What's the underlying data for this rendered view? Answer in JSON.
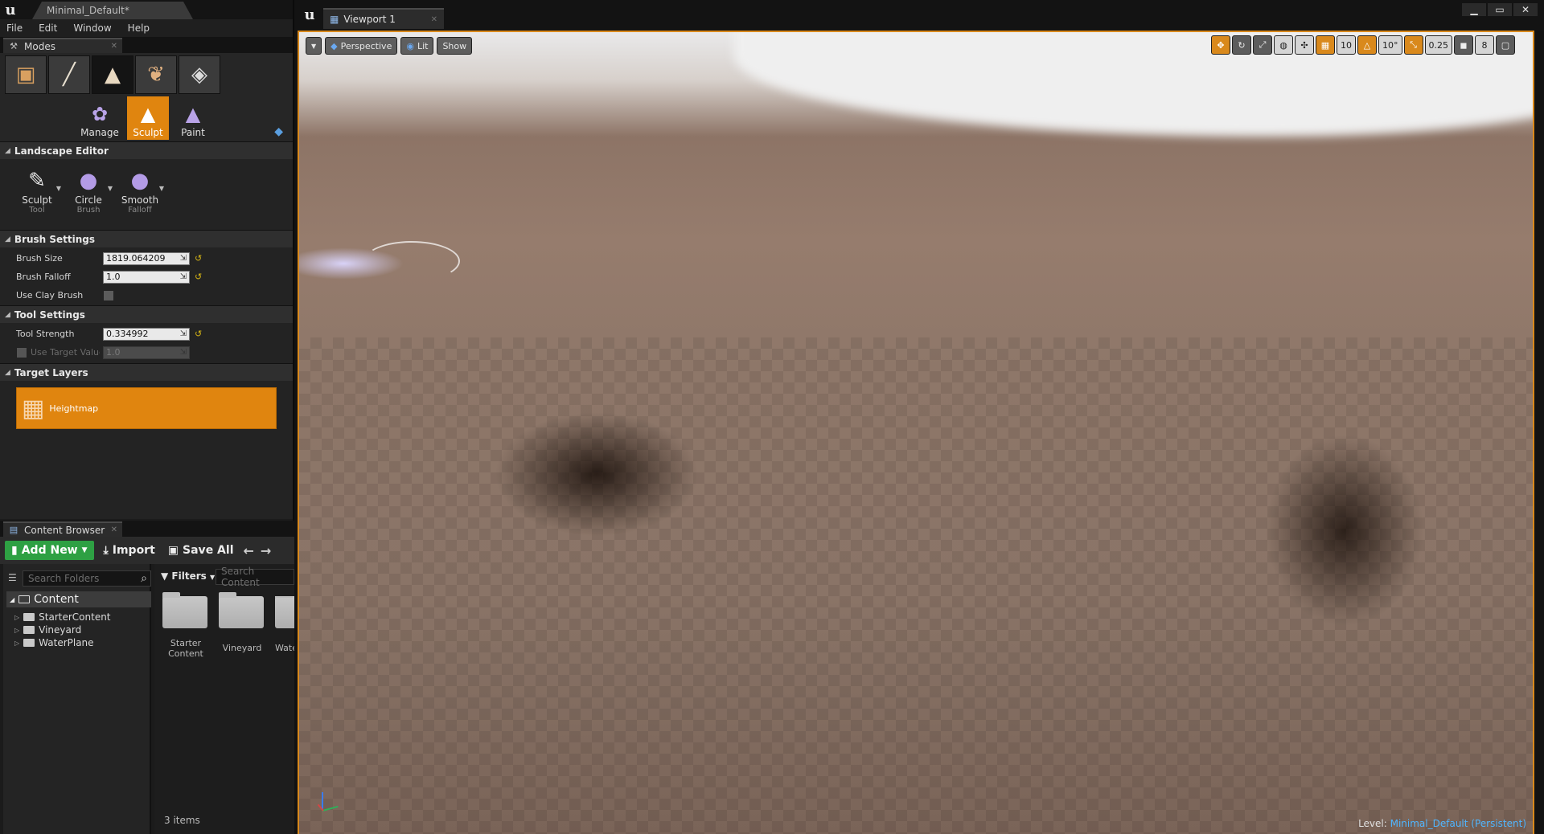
{
  "left_window": {
    "doc_tab": "Minimal_Default*",
    "menu": [
      "File",
      "Edit",
      "Window",
      "Help"
    ]
  },
  "modes": {
    "tab_label": "Modes",
    "mode_icons": [
      "place-mode-icon",
      "paint-mode-icon",
      "landscape-mode-icon",
      "foliage-mode-icon",
      "geometry-mode-icon"
    ],
    "tools": [
      "Manage",
      "Sculpt",
      "Paint"
    ],
    "active_tool": "Sculpt"
  },
  "landscape_editor": {
    "title": "Landscape Editor",
    "brush_tools": [
      {
        "line1": "Sculpt",
        "line2": "Tool"
      },
      {
        "line1": "Circle",
        "line2": "Brush"
      },
      {
        "line1": "Smooth",
        "line2": "Falloff"
      }
    ]
  },
  "brush_settings": {
    "title": "Brush Settings",
    "brush_size_label": "Brush Size",
    "brush_size_value": "1819.064209",
    "brush_falloff_label": "Brush Falloff",
    "brush_falloff_value": "1.0",
    "use_clay_label": "Use Clay Brush",
    "use_clay_checked": false
  },
  "tool_settings": {
    "title": "Tool Settings",
    "tool_strength_label": "Tool Strength",
    "tool_strength_value": "0.334992",
    "use_target_label": "Use Target Value",
    "use_target_value": "1.0"
  },
  "target_layers": {
    "title": "Target Layers",
    "items": [
      "Heightmap"
    ]
  },
  "content_browser": {
    "tab_label": "Content Browser",
    "add_new": "Add New",
    "import": "Import",
    "save_all": "Save All",
    "search_folders_placeholder": "Search Folders",
    "filters": "Filters",
    "search_content_placeholder": "Search Content",
    "root": "Content",
    "folders": [
      "StarterContent",
      "Vineyard",
      "WaterPlane"
    ],
    "assets": [
      {
        "name": "Starter Content"
      },
      {
        "name": "Vineyard"
      },
      {
        "name": "Wate"
      }
    ],
    "items_count": "3 items"
  },
  "viewport": {
    "tab_label": "Viewport 1",
    "perspective": "Perspective",
    "lit": "Lit",
    "show": "Show",
    "grid_snap": "10",
    "rotation_snap": "10°",
    "scale_snap": "0.25",
    "camera_speed": "8",
    "level_prefix": "Level:",
    "level_name": "Minimal_Default (Persistent)"
  },
  "colors": {
    "accent_orange": "#e0850f",
    "add_new_green": "#2ea043",
    "level_blue": "#4fb5ff"
  }
}
